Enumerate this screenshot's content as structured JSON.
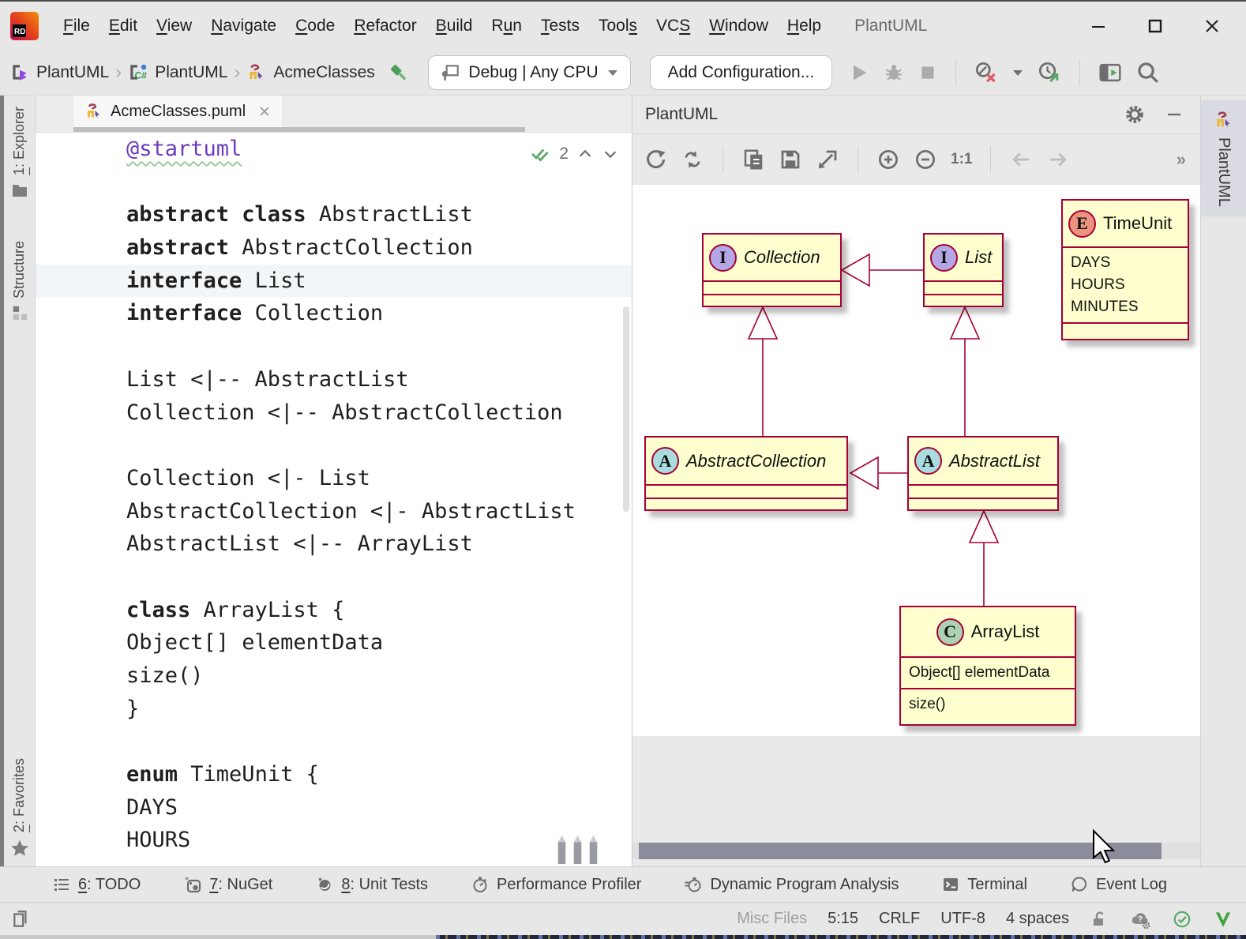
{
  "window": {
    "title": "PlantUML"
  },
  "menubar": {
    "items": [
      {
        "pre": "",
        "u": "F",
        "post": "ile"
      },
      {
        "pre": "",
        "u": "E",
        "post": "dit"
      },
      {
        "pre": "",
        "u": "V",
        "post": "iew"
      },
      {
        "pre": "",
        "u": "N",
        "post": "avigate"
      },
      {
        "pre": "",
        "u": "C",
        "post": "ode"
      },
      {
        "pre": "",
        "u": "R",
        "post": "efactor"
      },
      {
        "pre": "",
        "u": "B",
        "post": "uild"
      },
      {
        "pre": "R",
        "u": "u",
        "post": "n"
      },
      {
        "pre": "",
        "u": "T",
        "post": "ests"
      },
      {
        "pre": "Tool",
        "u": "s",
        "post": ""
      },
      {
        "pre": "VC",
        "u": "S",
        "post": ""
      },
      {
        "pre": "",
        "u": "W",
        "post": "indow"
      },
      {
        "pre": "",
        "u": "H",
        "post": "elp"
      }
    ]
  },
  "toolbar": {
    "breadcrumbs": [
      "PlantUML",
      "PlantUML",
      "AcmeClasses"
    ],
    "run_config": "Debug | Any CPU",
    "add_config": "Add Configuration..."
  },
  "editor": {
    "tab": "AcmeClasses.puml",
    "inspections_count": "2",
    "lines": [
      {
        "k": "",
        "t": "@startuml"
      },
      {
        "k": "",
        "t": ""
      },
      {
        "k": "abstract class",
        "t": " AbstractList"
      },
      {
        "k": "abstract",
        "t": " AbstractCollection"
      },
      {
        "k": "interface",
        "t": " List"
      },
      {
        "k": "interface",
        "t": " Collection"
      },
      {
        "k": "",
        "t": ""
      },
      {
        "k": "",
        "t": "List <|-- AbstractList"
      },
      {
        "k": "",
        "t": "Collection <|-- AbstractCollection"
      },
      {
        "k": "",
        "t": ""
      },
      {
        "k": "",
        "t": "Collection <|- List"
      },
      {
        "k": "",
        "t": "AbstractCollection <|- AbstractList"
      },
      {
        "k": "",
        "t": "AbstractList <|-- ArrayList"
      },
      {
        "k": "",
        "t": ""
      },
      {
        "k": "class",
        "t": " ArrayList {"
      },
      {
        "k": "",
        "t": "Object[] elementData"
      },
      {
        "k": "",
        "t": "size()"
      },
      {
        "k": "",
        "t": "}"
      },
      {
        "k": "",
        "t": ""
      },
      {
        "k": "enum",
        "t": " TimeUnit {"
      },
      {
        "k": "",
        "t": "DAYS"
      },
      {
        "k": "",
        "t": "HOURS"
      }
    ]
  },
  "preview": {
    "title": "PlantUML",
    "zoom_label": "1:1",
    "overflow": "»",
    "tab_vertical": "PlantUML"
  },
  "diagram": {
    "classes": [
      {
        "badge": "I",
        "name": "Collection",
        "stereotype": "interface"
      },
      {
        "badge": "I",
        "name": "List",
        "stereotype": "interface"
      },
      {
        "badge": "E",
        "name": "TimeUnit",
        "stereotype": "enum",
        "values": [
          "DAYS",
          "HOURS",
          "MINUTES"
        ]
      },
      {
        "badge": "A",
        "name": "AbstractCollection",
        "stereotype": "abstract"
      },
      {
        "badge": "A",
        "name": "AbstractList",
        "stereotype": "abstract"
      },
      {
        "badge": "C",
        "name": "ArrayList",
        "stereotype": "class",
        "fields": [
          "Object[] elementData"
        ],
        "methods": [
          "size()"
        ]
      }
    ],
    "colors": {
      "fill": "#FEFECE",
      "border": "#A80036",
      "badge_interface": "#B4A7E5",
      "badge_abstract": "#A9DCDF",
      "badge_class": "#ADD1B2",
      "badge_enum": "#EB937F"
    }
  },
  "toolwindows": {
    "left": [
      {
        "num": "1",
        "label": ": Explorer"
      },
      {
        "num": "",
        "label": "Structure"
      },
      {
        "num": "2",
        "label": ": Favorites"
      }
    ],
    "bottom": [
      {
        "num": "6",
        "label": ": TODO"
      },
      {
        "num": "7",
        "label": ": NuGet"
      },
      {
        "num": "8",
        "label": ": Unit Tests"
      },
      {
        "num": "",
        "label": "Performance Profiler"
      },
      {
        "num": "",
        "label": "Dynamic Program Analysis"
      },
      {
        "num": "",
        "label": "Terminal"
      },
      {
        "num": "",
        "label": "Event Log"
      }
    ]
  },
  "statusbar": {
    "context": "Misc Files",
    "caret": "5:15",
    "line_ending": "CRLF",
    "encoding": "UTF-8",
    "indent": "4 spaces"
  }
}
